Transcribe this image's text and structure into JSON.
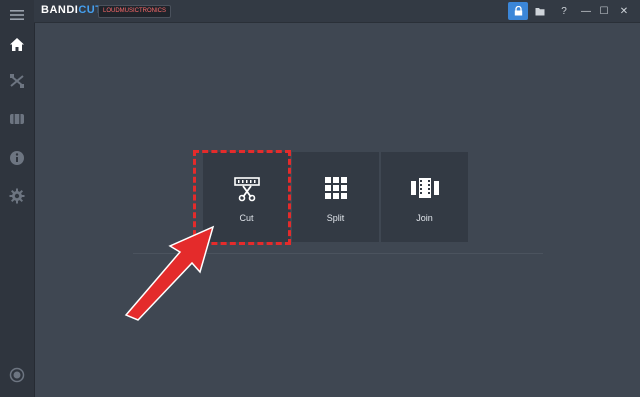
{
  "app": {
    "title_main": "BANDI",
    "title_accent": "CUT",
    "badge_text": "LOUDMUSICTRONICS"
  },
  "sidebar": {
    "items": [
      {
        "icon": "menu-icon"
      },
      {
        "icon": "home-icon"
      },
      {
        "icon": "cut-join-icon"
      },
      {
        "icon": "film-icon"
      },
      {
        "icon": "info-icon"
      },
      {
        "icon": "gear-icon"
      },
      {
        "icon": "record-icon"
      }
    ]
  },
  "titlebar": {
    "buttons": [
      {
        "icon": "lock-icon",
        "active": true
      },
      {
        "icon": "folder-icon"
      },
      {
        "icon": "help-icon",
        "label": "?"
      },
      {
        "icon": "minimize-icon",
        "label": "—"
      },
      {
        "icon": "maximize-icon",
        "label": "☐"
      },
      {
        "icon": "close-icon",
        "label": "✕"
      }
    ]
  },
  "modes": {
    "cut_label": "Cut",
    "split_label": "Split",
    "join_label": "Join"
  },
  "colors": {
    "background": "#3f4752",
    "sidebar": "#2f353e",
    "tile": "#333a44",
    "accent": "#3b86d8",
    "highlight": "#e42b2b"
  }
}
